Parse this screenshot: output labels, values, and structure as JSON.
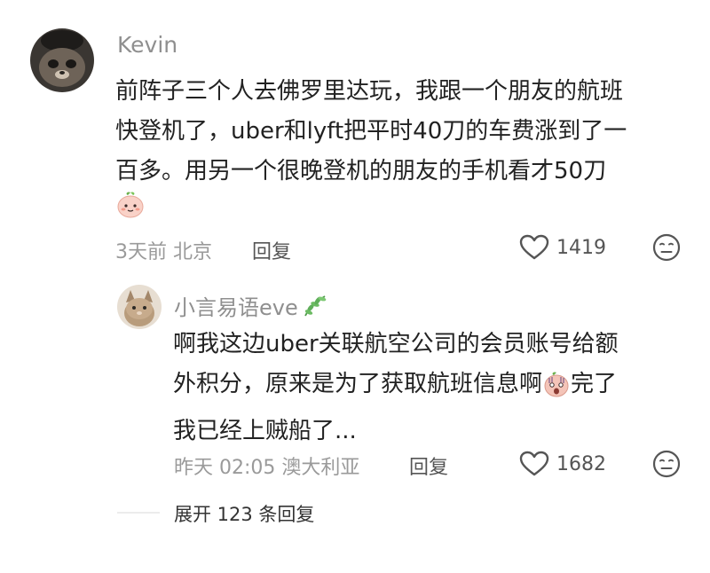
{
  "comment": {
    "author": "Kevin",
    "lines": [
      "前阵子三个人去佛罗里达玩，我跟一个朋友的航班",
      "快登机了，uber和lyft把平时40刀的车费涨到了一",
      "百多。用另一个很晚登机的朋友的手机看才50刀"
    ],
    "emoji": "peach-face-emoji",
    "meta": "3天前 北京",
    "reply_label": "回复",
    "likes": "1419"
  },
  "reply": {
    "author": "小言易语eve",
    "author_badge": "leaf-icon",
    "line1": "啊我这边uber关联航空公司的会员账号给额",
    "line2_a": "外积分，原来是为了获取航班信息啊",
    "line2_b": "完了",
    "line3": "我已经上贼船了...",
    "inline_emoji": "shocked-face-emoji",
    "meta": "昨天 02:05 澳大利亚",
    "reply_label": "回复",
    "likes": "1682"
  },
  "expand": {
    "label": "展开 123 条回复"
  },
  "colors": {
    "text": "#222222",
    "meta": "#9a9a9a",
    "name": "#8f8f8f",
    "peach": "#f7c8c0",
    "leaf": "#5fae5a"
  }
}
